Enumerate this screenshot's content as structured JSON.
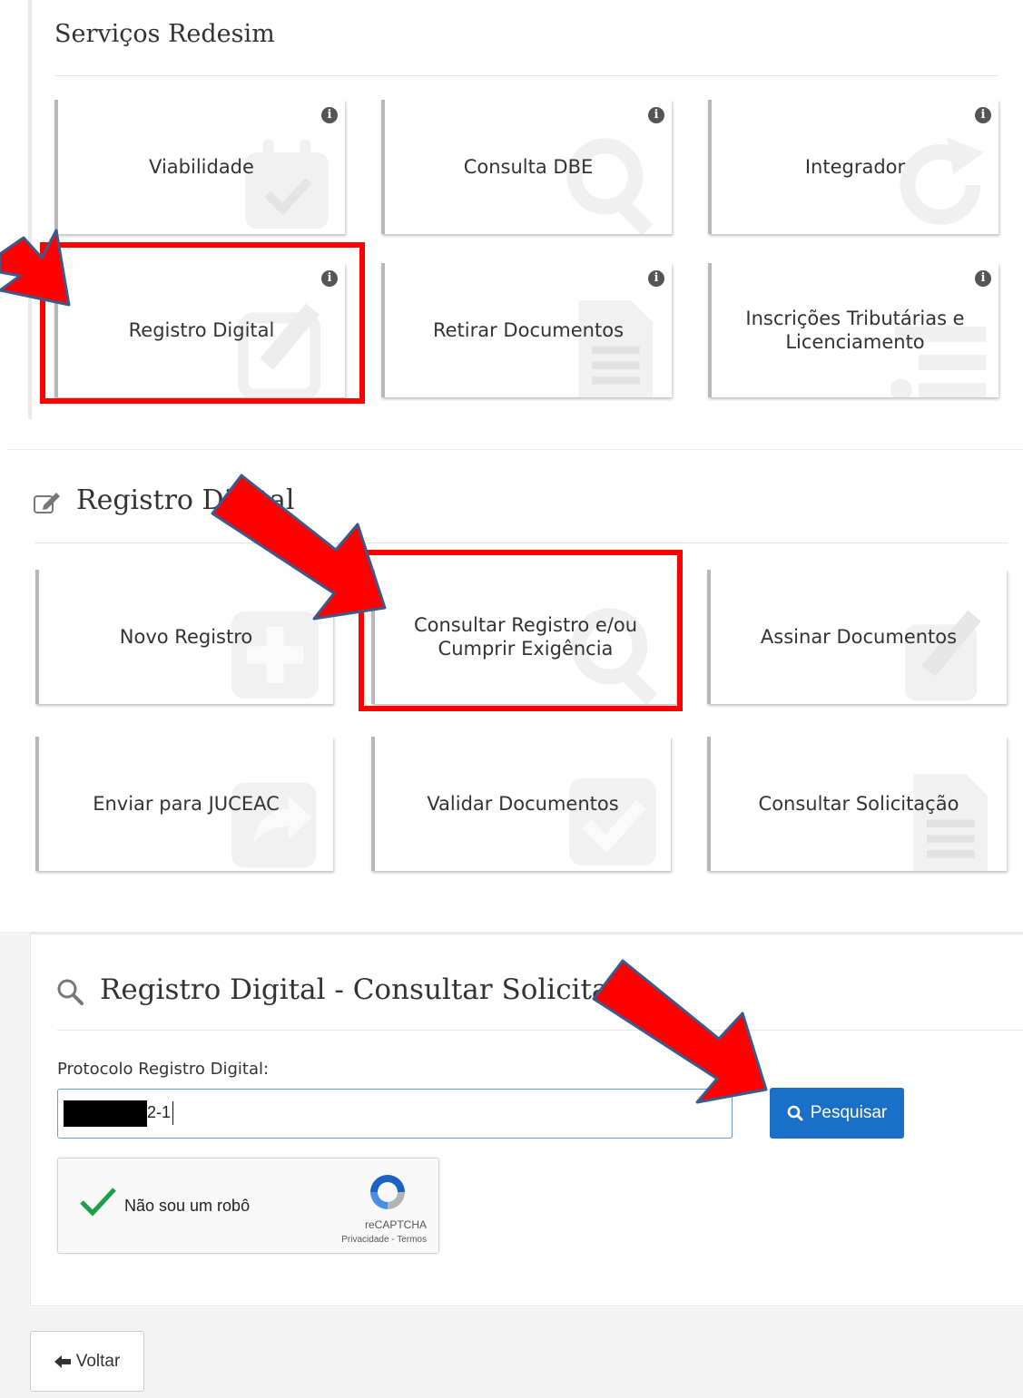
{
  "servicos": {
    "title": "Serviços Redesim",
    "tiles": [
      {
        "label": "Viabilidade",
        "icon": "calendar-check-icon"
      },
      {
        "label": "Consulta DBE",
        "icon": "magnifier-icon"
      },
      {
        "label": "Integrador",
        "icon": "refresh-icon"
      },
      {
        "label": "Registro Digital",
        "icon": "edit-icon"
      },
      {
        "label": "Retirar Documentos",
        "icon": "document-icon"
      },
      {
        "label": "Inscrições Tributárias e Licenciamento",
        "icon": "list-icon"
      }
    ]
  },
  "registro": {
    "title": "Registro Digital",
    "tiles": [
      {
        "label": "Novo Registro",
        "icon": "plus-icon"
      },
      {
        "label": "Consultar Registro e/ou Cumprir Exigência",
        "icon": "magnifier-icon"
      },
      {
        "label": "Assinar Documentos",
        "icon": "edit-icon"
      },
      {
        "label": "Enviar para JUCEAC",
        "icon": "share-icon"
      },
      {
        "label": "Validar Documentos",
        "icon": "check-icon"
      },
      {
        "label": "Consultar Solicitação",
        "icon": "document-icon"
      }
    ]
  },
  "consulta": {
    "title": "Registro Digital - Consultar Solicitação",
    "field_label": "Protocolo Registro Digital:",
    "protocol_value_visible": "2-1",
    "search_button": "Pesquisar",
    "recaptcha": {
      "label": "Não sou um robô",
      "brand": "reCAPTCHA",
      "links": "Privacidade - Termos",
      "checked": true
    }
  },
  "back_button": "Voltar",
  "colors": {
    "highlight": "#ff0000",
    "arrow_stroke": "#3a5a8c",
    "primary_button": "#1a6fc9",
    "tile_border": "#b8b8b8"
  }
}
